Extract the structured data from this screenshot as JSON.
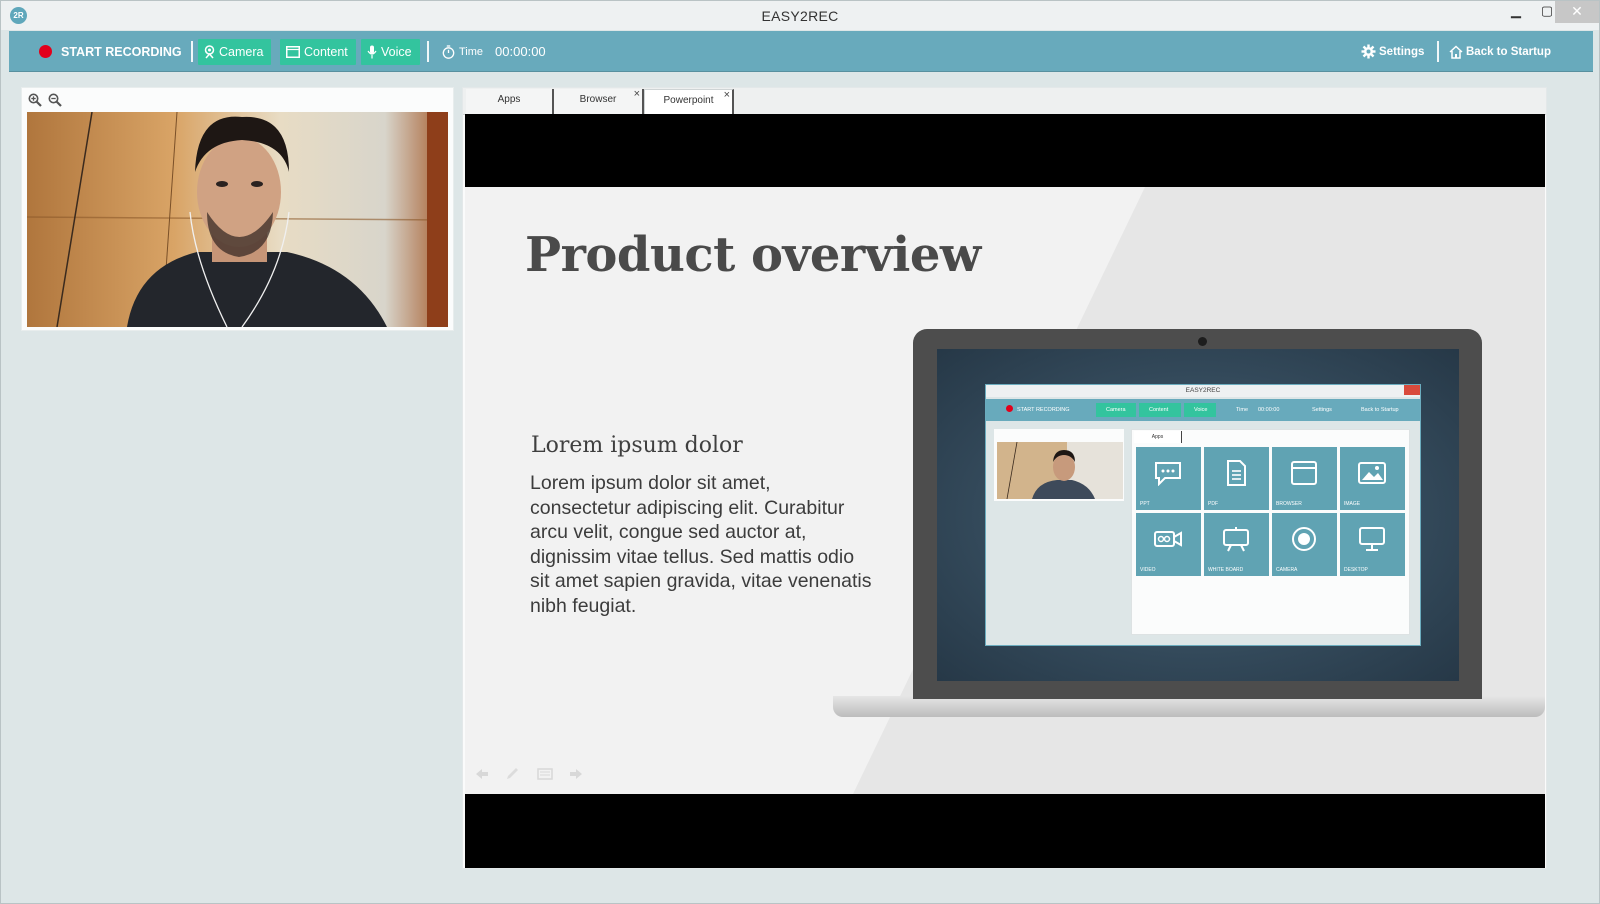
{
  "window": {
    "title": "EASY2REC",
    "logo": "2R",
    "controls": {
      "minimize": "▁",
      "maximize": "▢",
      "close": "✕"
    }
  },
  "toolbar": {
    "record_label": "START RECORDING",
    "camera_label": "Camera",
    "content_label": "Content",
    "voice_label": "Voice",
    "time_label": "Time",
    "time_value": "00:00:00",
    "settings_label": "Settings",
    "back_label": "Back to Startup",
    "colors": {
      "bar": "#68aabc",
      "toggle_active": "#33c49e",
      "record_dot": "#e3001b"
    }
  },
  "tabs": [
    {
      "label": "Apps",
      "closable": false
    },
    {
      "label": "Browser",
      "closable": true
    },
    {
      "label": "Powerpoint",
      "closable": true,
      "active": true
    }
  ],
  "slide": {
    "title": "Product overview",
    "subtitle": "Lorem ipsum dolor",
    "body": "Lorem ipsum dolor sit amet, consectetur adipiscing elit. Curabitur arcu velit, congue sed auctor at, dignissim vitae tellus. Sed mattis odio sit amet sapien gravida, vitae venenatis nibh feugiat."
  },
  "mockup": {
    "title": "EASY2REC",
    "record_label": "START RECORDING",
    "camera_label": "Camera",
    "content_label": "Content",
    "voice_label": "Voice",
    "time_label": "Time",
    "time_value": "00:00:00",
    "settings_label": "Settings",
    "back_label": "Back to Startup",
    "tab_label": "Apps",
    "tiles": [
      "PPT",
      "PDF",
      "BROWSER",
      "IMAGE",
      "VIDEO",
      "WHITE BOARD",
      "CAMERA",
      "DESKTOP"
    ]
  }
}
